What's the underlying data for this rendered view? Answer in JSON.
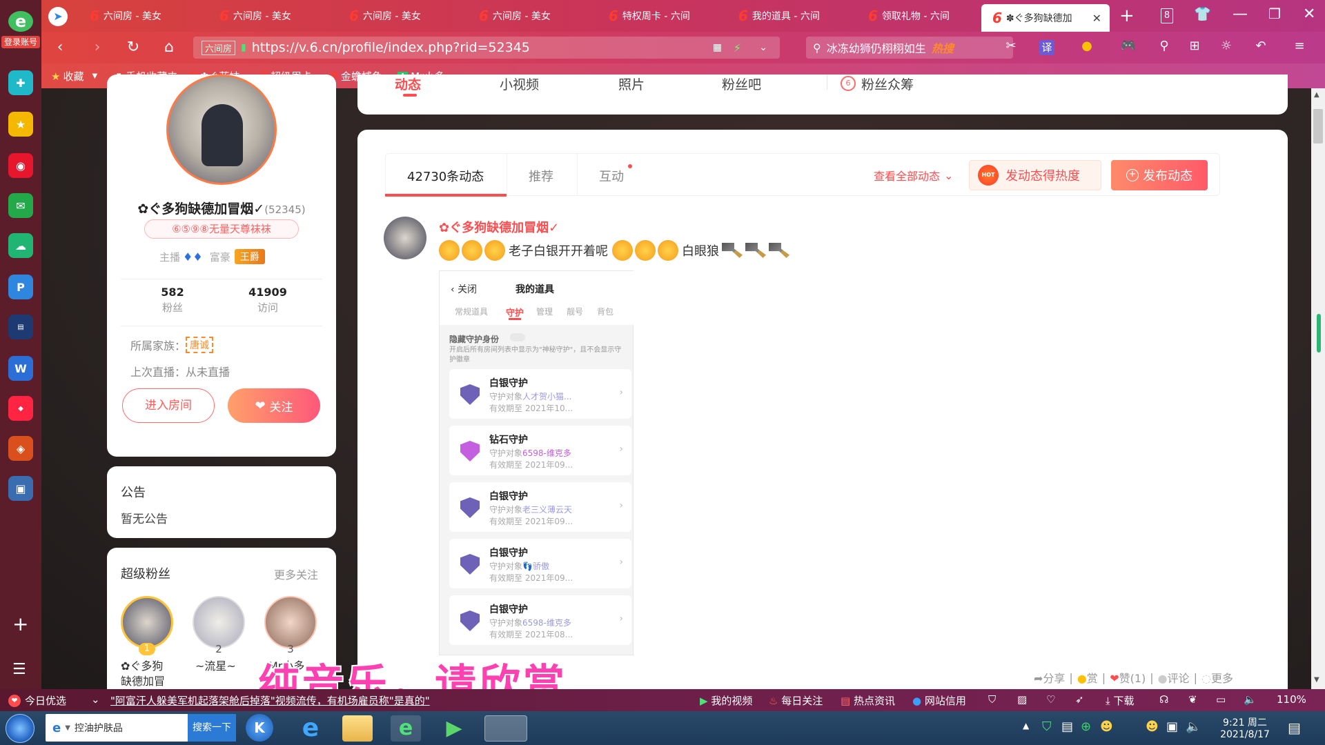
{
  "browser": {
    "login_badge": "登录账号",
    "tabs": [
      {
        "label": "六间房 - 美女"
      },
      {
        "label": "六间房 - 美女"
      },
      {
        "label": "六间房 - 美女"
      },
      {
        "label": "六间房 - 美女"
      },
      {
        "label": "特权周卡 - 六间"
      },
      {
        "label": "我的道具 - 六间"
      },
      {
        "label": "领取礼物 - 六间"
      },
      {
        "label": "✽ぐ多狗缺德加"
      }
    ],
    "tab_count": "8",
    "url_site_badge": "六间房",
    "url": "https://v.6.cn/profile/index.php?rid=52345",
    "search_text": "冰冻幼狮仍栩栩如生",
    "search_hot": "热搜",
    "translate_label": "译",
    "bookmarks": [
      {
        "label": "收藏"
      },
      {
        "label": "手机收藏夹"
      },
      {
        "label": "✽ぐ蓝妹"
      },
      {
        "label": "超级周卡"
      },
      {
        "label": "金蟾捕鱼"
      },
      {
        "label": "Mr小多"
      }
    ]
  },
  "profile": {
    "name": "✿ぐ多狗缺德加冒烟✓",
    "rid": "(52345)",
    "badge": "⑥⑤⑨⑧无量天尊袜袜",
    "anchor_label": "主播",
    "rich_label": "富豪",
    "rich_rank": "王爵",
    "stats": [
      {
        "value": "582",
        "label": "粉丝"
      },
      {
        "value": "41909",
        "label": "访问"
      }
    ],
    "family_label": "所属家族：",
    "family_value": "唐诚",
    "last_live": "上次直播：从未直播",
    "enter_room": "进入房间",
    "follow": "关注"
  },
  "notice": {
    "title": "公告",
    "body": "暂无公告"
  },
  "superfans": {
    "title": "超级粉丝",
    "more": "更多关注",
    "fans": [
      {
        "rank": "1",
        "name1": "✿ぐ多狗",
        "name2": "缺德加冒"
      },
      {
        "rank": "2",
        "name1": "~流星~",
        "name2": ""
      },
      {
        "rank": "3",
        "name1": "Mr小多",
        "name2": ""
      }
    ]
  },
  "top_tabs": [
    {
      "label": "动态"
    },
    {
      "label": "小视频"
    },
    {
      "label": "照片"
    },
    {
      "label": "粉丝吧"
    },
    {
      "label": "粉丝众筹"
    }
  ],
  "feed": {
    "tabs": [
      {
        "label": "42730条动态"
      },
      {
        "label": "推荐"
      },
      {
        "label": "互动"
      }
    ],
    "view_all": "查看全部动态",
    "heat_button": "发动态得热度",
    "hot_badge": "HOT",
    "post_button": "发布动态",
    "post": {
      "author": "✿ぐ多狗缺德加冒烟✓",
      "text1": "老子白银开开着呢",
      "text2": "白眼狼"
    },
    "actions": [
      {
        "label": "分享"
      },
      {
        "label": "赏"
      },
      {
        "label": "赞(1)"
      },
      {
        "label": "评论"
      },
      {
        "label": "更多"
      }
    ]
  },
  "phone": {
    "close": "关闭",
    "title": "我的道具",
    "tabs": [
      "常规道具",
      "守护",
      "管理",
      "靓号",
      "背包"
    ],
    "hide_title": "隐藏守护身份",
    "hide_desc": "开启后所有房间列表中显示为\"神秘守护\"，且不会显示守护徽章",
    "items": [
      {
        "title": "白银守护",
        "target_prefix": "守护对象",
        "target": "人才贺小猫...",
        "expire": "有效期至 2021年10..."
      },
      {
        "title": "钻石守护",
        "target_prefix": "守护对象",
        "target": "6598-维克多",
        "expire": "有效期至 2021年09..."
      },
      {
        "title": "白银守护",
        "target_prefix": "守护对象",
        "target": "老三义薄云天",
        "expire": "有效期至 2021年09..."
      },
      {
        "title": "白银守护",
        "target_prefix": "守护对象",
        "target": "👣骄傲",
        "expire": "有效期至 2021年09..."
      },
      {
        "title": "白银守护",
        "target_prefix": "守护对象",
        "target": "6598-维克多",
        "expire": "有效期至 2021年08..."
      }
    ]
  },
  "subtitle": "纯音乐，请欣赏",
  "statusbar": {
    "news_label": "今日优选",
    "news": "\"阿富汗人躲美军机起落架舱后掉落\"视频流传，有机场雇员称\"是真的\"",
    "items": [
      "我的视频",
      "每日关注",
      "热点资讯",
      "网站信用"
    ],
    "download": "下载",
    "zoom": "110%"
  },
  "taskbar": {
    "search_placeholder": "控油护肤品",
    "search_button": "搜索一下",
    "time": "9:21 周二",
    "date": "2021/8/17"
  },
  "colors": {
    "accent": "#ff4d4f",
    "follow_gradient_start": "#ff9a6a",
    "follow_gradient_end": "#ff5a7a",
    "subtitle": "#ff3fb0"
  }
}
